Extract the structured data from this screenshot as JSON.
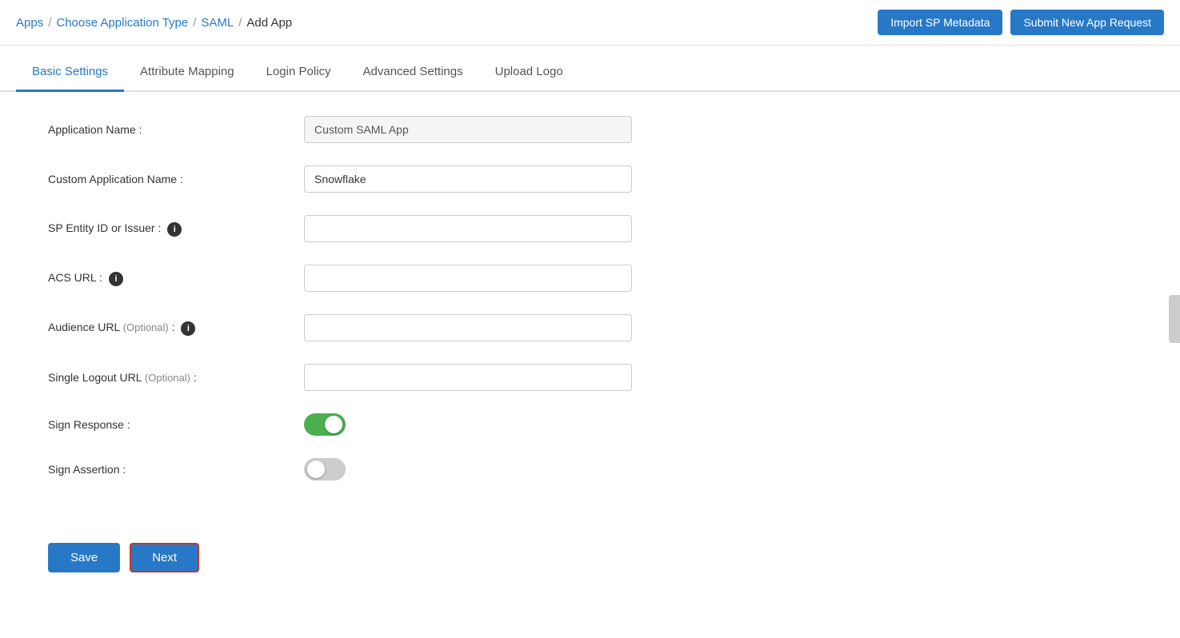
{
  "header": {
    "breadcrumb": {
      "apps_label": "Apps",
      "choose_app_label": "Choose Application Type",
      "saml_label": "SAML",
      "add_app_label": "Add App"
    },
    "buttons": {
      "import_sp_metadata": "Import SP Metadata",
      "submit_new_app_request": "Submit New App Request"
    }
  },
  "tabs": [
    {
      "id": "basic-settings",
      "label": "Basic Settings",
      "active": true
    },
    {
      "id": "attribute-mapping",
      "label": "Attribute Mapping",
      "active": false
    },
    {
      "id": "login-policy",
      "label": "Login Policy",
      "active": false
    },
    {
      "id": "advanced-settings",
      "label": "Advanced Settings",
      "active": false
    },
    {
      "id": "upload-logo",
      "label": "Upload Logo",
      "active": false
    }
  ],
  "form": {
    "fields": [
      {
        "id": "application-name",
        "label": "Application Name :",
        "value": "Custom SAML App",
        "placeholder": "",
        "readonly": true,
        "has_info": false,
        "optional": false
      },
      {
        "id": "custom-application-name",
        "label": "Custom Application Name :",
        "value": "Snowflake",
        "placeholder": "",
        "readonly": false,
        "has_info": false,
        "optional": false
      },
      {
        "id": "sp-entity-id",
        "label": "SP Entity ID or Issuer :",
        "value": "",
        "placeholder": "",
        "readonly": false,
        "has_info": true,
        "optional": false
      },
      {
        "id": "acs-url",
        "label": "ACS URL :",
        "value": "",
        "placeholder": "",
        "readonly": false,
        "has_info": true,
        "optional": false
      },
      {
        "id": "audience-url",
        "label": "Audience URL",
        "label_optional": "(Optional)",
        "label_suffix": " :",
        "value": "",
        "placeholder": "",
        "readonly": false,
        "has_info": true,
        "optional": true
      },
      {
        "id": "single-logout-url",
        "label": "Single Logout URL",
        "label_optional": "(Optional)",
        "label_suffix": " :",
        "value": "",
        "placeholder": "",
        "readonly": false,
        "has_info": false,
        "optional": true
      }
    ],
    "toggles": [
      {
        "id": "sign-response",
        "label": "Sign Response :",
        "state": "on"
      },
      {
        "id": "sign-assertion",
        "label": "Sign Assertion :",
        "state": "off"
      }
    ]
  },
  "bottom_buttons": {
    "save_label": "Save",
    "next_label": "Next"
  },
  "info_icon_symbol": "i"
}
